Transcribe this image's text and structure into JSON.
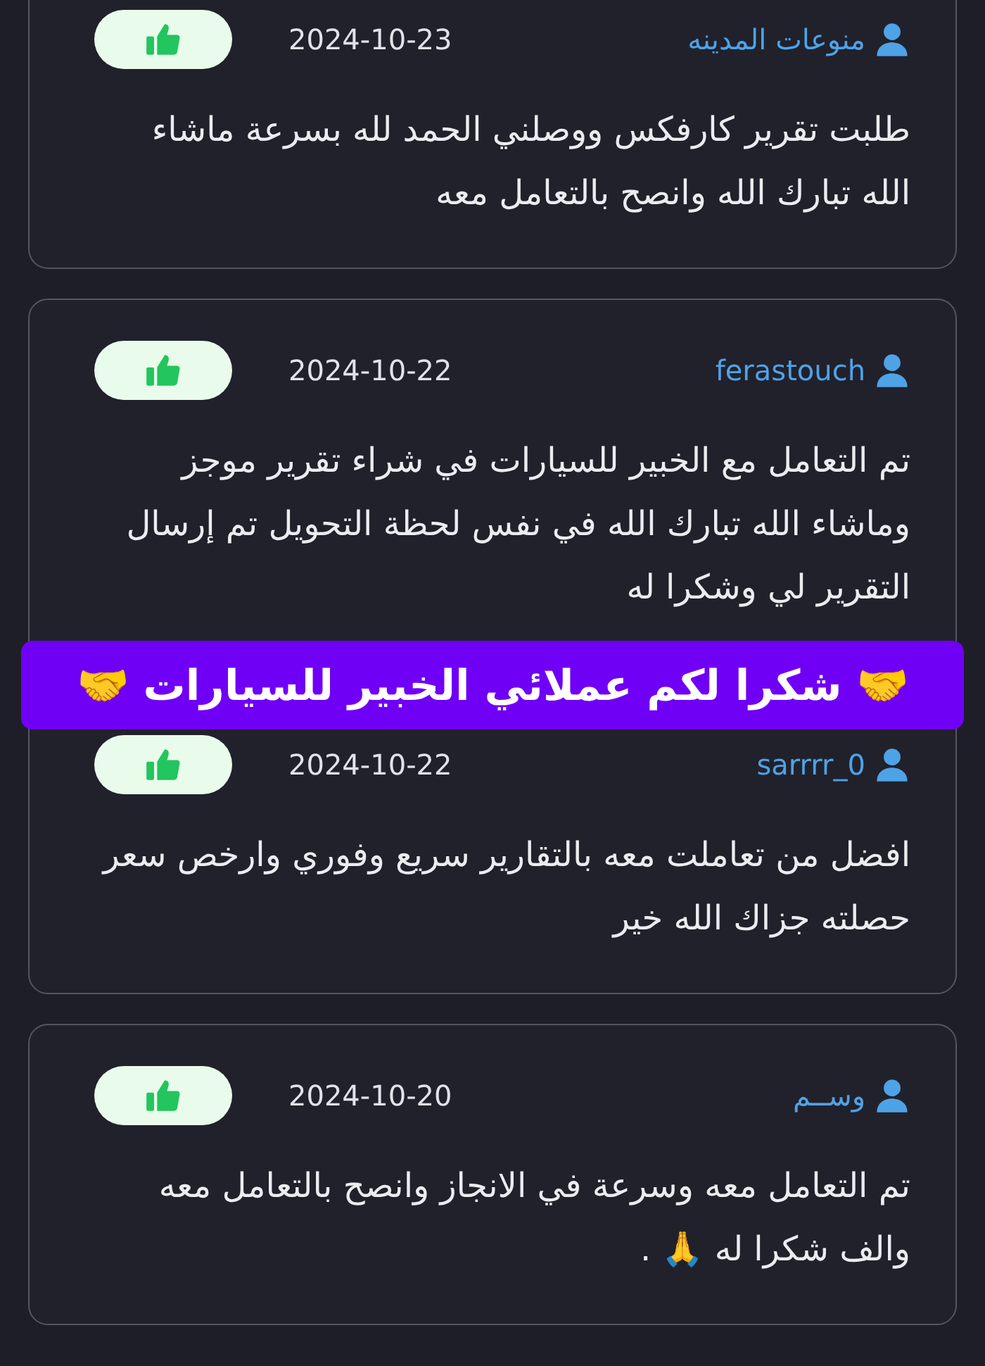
{
  "reviews": [
    {
      "user": "منوعات المدينه",
      "date": "2024-10-23",
      "text": "طلبت تقرير كارفكس ووصلني الحمد لله بسرعة ماشاء الله تبارك الله وانصح بالتعامل معه"
    },
    {
      "user": "ferastouch",
      "date": "2024-10-22",
      "text": "تم التعامل مع الخبير للسيارات في شراء تقرير موجز وماشاء الله تبارك الله في نفس لحظة التحويل تم إرسال التقرير لي وشكرا له"
    },
    {
      "user": "sarrrr_0",
      "date": "2024-10-22",
      "text": "افضل من تعاملت معه بالتقارير سريع وفوري وارخص سعر حصلته جزاك الله خير"
    },
    {
      "user": "وســم",
      "date": "2024-10-20",
      "text": "تم التعامل معه وسرعة في الانجاز وانصح بالتعامل معه والف شكرا له 🙏 ."
    }
  ],
  "banner": {
    "text": "🤝 شكرا لكم عملائي الخبير للسيارات 🤝"
  }
}
